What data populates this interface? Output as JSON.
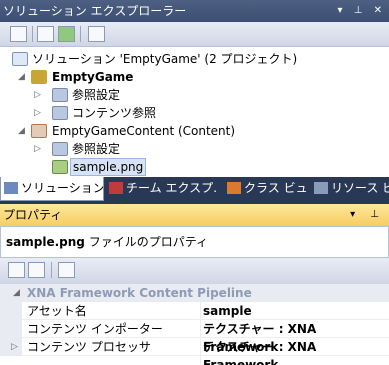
{
  "solution_explorer": {
    "title": "ソリューション エクスプローラー",
    "title_controls": "▾ ⊥ ✕",
    "tree": [
      {
        "label": "ソリューション 'EmptyGame' (2 プロジェクト)",
        "bold": false,
        "expander": ""
      },
      {
        "label": "EmptyGame",
        "bold": true,
        "expander": "◢"
      },
      {
        "label": "参照設定",
        "bold": false,
        "expander": "▷"
      },
      {
        "label": "コンテンツ参照",
        "bold": false,
        "expander": "▷"
      },
      {
        "label": "EmptyGameContent (Content)",
        "bold": false,
        "expander": "◢"
      },
      {
        "label": "参照設定",
        "bold": false,
        "expander": "▷"
      },
      {
        "label": "sample.png",
        "bold": false,
        "expander": ""
      }
    ]
  },
  "bottom_tabs": [
    {
      "label": "ソリューション…"
    },
    {
      "label": "チーム エクスプ…"
    },
    {
      "label": "クラス ビュー"
    },
    {
      "label": "リソース ビュー"
    }
  ],
  "properties": {
    "title": "プロパティ",
    "title_controls": "▾ ⊥",
    "object_bold": "sample.png",
    "object_rest": " ファイルのプロパティ",
    "category": "XNA Framework Content Pipeline",
    "category_expander": "◢",
    "rows": [
      {
        "name": "アセット名",
        "value": "sample",
        "expander": ""
      },
      {
        "name": "コンテンツ インポーター",
        "value": "テクスチャー : XNA Framework",
        "expander": ""
      },
      {
        "name": "コンテンツ プロセッサ",
        "value": "テクスチャー : XNA Framework",
        "expander": "▷"
      }
    ]
  }
}
